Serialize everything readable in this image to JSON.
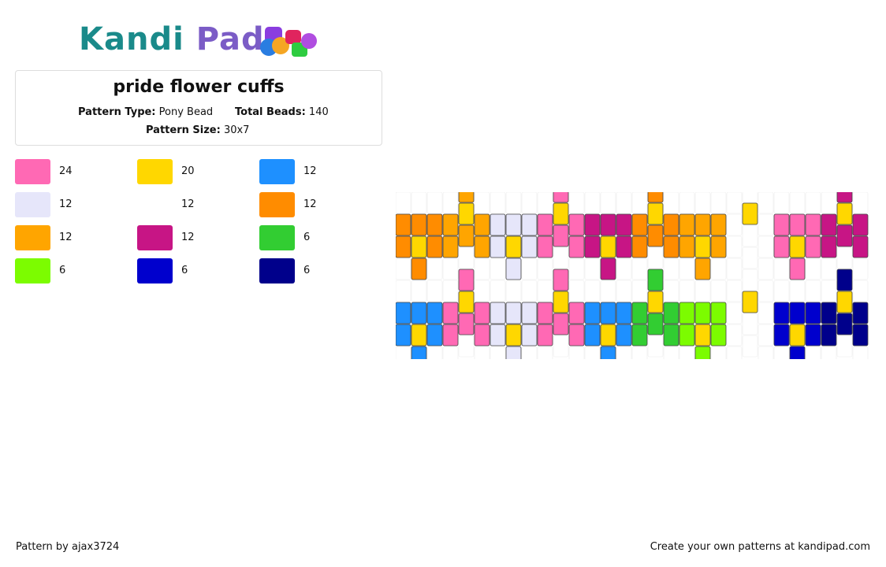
{
  "logo": {
    "part1": "Kandi",
    "part2": "Pad"
  },
  "pattern": {
    "title": "pride flower cuffs",
    "type_label": "Pattern Type:",
    "type_value": "Pony Bead",
    "beads_label": "Total Beads:",
    "beads_value": "140",
    "size_label": "Pattern Size:",
    "size_value": "30x7"
  },
  "palette": [
    {
      "color": "#ff69b4",
      "count": "24"
    },
    {
      "color": "#ffd700",
      "count": "20"
    },
    {
      "color": "#1e90ff",
      "count": "12"
    },
    {
      "color": "#e6e6fa",
      "count": "12"
    },
    {
      "color": "#ffffff",
      "count": "12"
    },
    {
      "color": "#ff8c00",
      "count": "12"
    },
    {
      "color": "#ffa500",
      "count": "12"
    },
    {
      "color": "#c71585",
      "count": "12"
    },
    {
      "color": "#32cd32",
      "count": "6"
    },
    {
      "color": "#7cfc00",
      "count": "6"
    },
    {
      "color": "#0000cd",
      "count": "6"
    },
    {
      "color": "#00008b",
      "count": "6"
    }
  ],
  "grid": {
    "row1": [
      "#ff8c00",
      "#ffa500",
      "#e6e6fa",
      "#ff69b4",
      "#c71585",
      "#ff8c00",
      "#ffa500",
      "#ffffff",
      "#ff69b4",
      "#c71585"
    ],
    "row2": [
      "#1e90ff",
      "#ff69b4",
      "#e6e6fa",
      "#ff69b4",
      "#1e90ff",
      "#32cd32",
      "#7cfc00",
      "#ffffff",
      "#0000cd",
      "#00008b"
    ],
    "center_color": "#ffd700",
    "empty_color": "#ffffff"
  },
  "footer": {
    "left": "Pattern by ajax3724",
    "right": "Create your own patterns at kandipad.com"
  }
}
